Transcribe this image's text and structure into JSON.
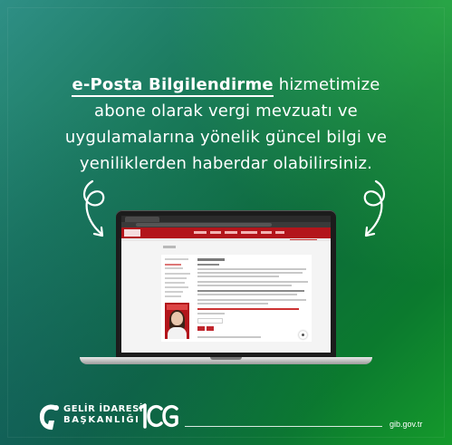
{
  "headline": {
    "highlight": "e-Posta Bilgilendirme",
    "line1_rest": " hizmetimize",
    "line2": "abone olarak vergi mevzuatı ve",
    "line3": "uygulamalarına yönelik güncel bilgi ve",
    "line4": "yeniliklerden haberdar olabilirsiniz."
  },
  "icons": {
    "left_arrow": "curly-down-arrow-icon",
    "right_arrow": "curly-down-arrow-icon",
    "chat": "chat-bubble-icon"
  },
  "footer": {
    "logo_line1": "GELİR İDARESİ",
    "logo_line2": "BAŞKANLIĞI",
    "anniversary_logo": "100",
    "url": "gib.gov.tr"
  },
  "colors": {
    "background_start": "#2f8f86",
    "background_end": "#159a2c",
    "site_red": "#b3151b",
    "text": "#ffffff"
  }
}
